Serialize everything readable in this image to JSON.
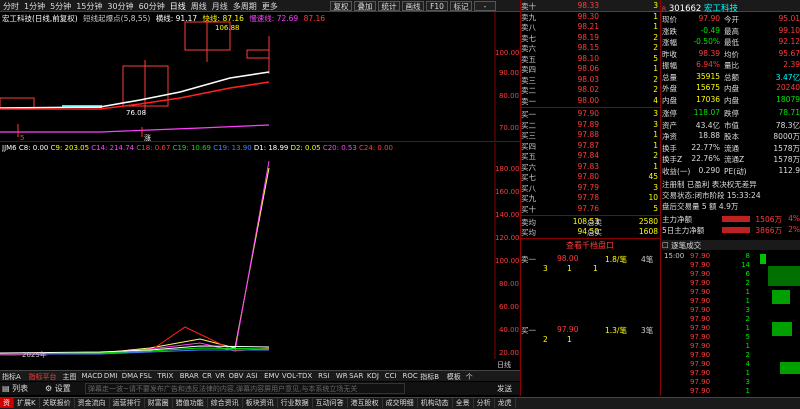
{
  "toolbar": {
    "periods": [
      "分时",
      "1分钟",
      "5分钟",
      "15分钟",
      "30分钟",
      "60分钟",
      "日线",
      "周线",
      "月线",
      "多周期",
      "更多"
    ],
    "active": "日线",
    "buttons": [
      "复权",
      "叠加",
      "统计",
      "画线",
      "F10",
      "标记",
      "-"
    ]
  },
  "chart_header": {
    "stock": "宏工科技(日线,前复权)",
    "indicator": "短线起爆点(5,8,55)",
    "s1": "横线: 91.17",
    "s2": "快线: 87.16",
    "s3": "慢速线: 72.69",
    "s4": "87.16"
  },
  "price_axis": [
    "100.00",
    "90.00",
    "80.00",
    "70.00"
  ],
  "annot": {
    "high": "106.88",
    "low": "76.08",
    "sig": "5",
    "sig2": "涨"
  },
  "sub_header": {
    "name": "JJM6",
    "c8": "C8: 0.00",
    "c9": "C9: 203.05",
    "c14": "C14: 214.74",
    "c18": "C18: 0.67",
    "c19": "C19: 10.69",
    "c19b": "C19: 13.90",
    "d1": "D1: 18.99",
    "d2": "D2: 0.05",
    "c20": "C20: 0.53",
    "c24": "C24: 0.00"
  },
  "sub_axis": [
    "180.00",
    "160.00",
    "140.00",
    "120.00",
    "100.00",
    "80.00",
    "60.00",
    "40.00",
    "20.00"
  ],
  "year": "2025年",
  "ind_tabs": [
    "指标A",
    "指标平台",
    "主图",
    "MACD",
    "DMI",
    "DMA",
    "FSL",
    "TRIX",
    "BRAR",
    "CR",
    "VR",
    "OBV",
    "ASI",
    "EMV",
    "VOL-TDX",
    "RSI",
    "WR",
    "SAR",
    "KDJ",
    "CCI",
    "ROC",
    "指标B",
    "模板",
    "个"
  ],
  "footer_left": {
    "list": "列表",
    "settings": "设置"
  },
  "footer_notice": "弹幕走一波~请不要发布广告和违反法律的内容,弹幕内容屏用户意见,与本系统立场无关",
  "footer_right": {
    "daily": "日线",
    "send": "发送"
  },
  "orderbook": {
    "asks": [
      {
        "l": "卖十",
        "p": "98.33",
        "v": "3"
      },
      {
        "l": "卖九",
        "p": "98.30",
        "v": "1"
      },
      {
        "l": "卖八",
        "p": "98.21",
        "v": "1"
      },
      {
        "l": "卖七",
        "p": "98.19",
        "v": "2"
      },
      {
        "l": "卖六",
        "p": "98.15",
        "v": "2"
      },
      {
        "l": "卖五",
        "p": "98.10",
        "v": "5"
      },
      {
        "l": "卖四",
        "p": "98.06",
        "v": "1"
      },
      {
        "l": "卖三",
        "p": "98.03",
        "v": "2"
      },
      {
        "l": "卖二",
        "p": "98.02",
        "v": "2"
      },
      {
        "l": "卖一",
        "p": "98.00",
        "v": "4"
      }
    ],
    "bids": [
      {
        "l": "买一",
        "p": "97.90",
        "v": "3"
      },
      {
        "l": "买二",
        "p": "97.89",
        "v": "3"
      },
      {
        "l": "买三",
        "p": "97.88",
        "v": "1"
      },
      {
        "l": "买四",
        "p": "97.87",
        "v": "1"
      },
      {
        "l": "买五",
        "p": "97.84",
        "v": "2"
      },
      {
        "l": "买六",
        "p": "97.83",
        "v": "1"
      },
      {
        "l": "买七",
        "p": "97.80",
        "v": "45"
      },
      {
        "l": "买八",
        "p": "97.79",
        "v": "3"
      },
      {
        "l": "买九",
        "p": "97.78",
        "v": "10"
      },
      {
        "l": "买十",
        "p": "97.76",
        "v": "5"
      }
    ],
    "avg_ask": {
      "l": "卖均",
      "p": "108.53",
      "tl": "总卖",
      "tv": "2580"
    },
    "avg_bid": {
      "l": "买均",
      "p": "94.50",
      "tl": "总买",
      "tv": "1608"
    }
  },
  "depth": {
    "title": "查看千档盘口",
    "ask": {
      "l": "卖一",
      "p": "98.00",
      "r": "1.8/笔",
      "c": "4笔",
      "q": [
        "3",
        "1",
        "1"
      ]
    },
    "bid": {
      "l": "买一",
      "p": "97.90",
      "r": "1.3/笔",
      "c": "3笔",
      "q": [
        "2",
        "1"
      ]
    }
  },
  "stock": {
    "code": "301662",
    "name": "宏工科技",
    "rows": [
      [
        "现价",
        "97.90",
        "今开",
        "95.01"
      ],
      [
        "涨跌",
        "-0.49",
        "最高",
        "99.10"
      ],
      [
        "涨幅",
        "-0.50%",
        "最低",
        "92.12"
      ],
      [
        "昨收",
        "98.39",
        "均价",
        "95.67"
      ],
      [
        "振幅",
        "6.94%",
        "量比",
        "2.39"
      ],
      [
        "总量",
        "35915",
        "总额",
        "3.47亿"
      ],
      [
        "外盘",
        "15675",
        "内盘",
        "20240"
      ],
      [
        "内盘",
        "17036",
        "内盘",
        "18079"
      ],
      [
        "涨停",
        "118.07",
        "跌停",
        "78.71"
      ],
      [
        "资产",
        "43.4亿",
        "市值",
        "78.3亿"
      ],
      [
        "净资",
        "18.88",
        "股本",
        "8000万"
      ],
      [
        "换手",
        "22.77%",
        "流通",
        "1578万"
      ],
      [
        "换手Z",
        "22.76%",
        "流通Z",
        "1578万"
      ],
      [
        "收益(一)",
        "0.290",
        "PE(动)",
        "112.9"
      ]
    ],
    "tags": "注册制 已盈利 表决权无差异",
    "status": "交易状态:闭市阶段 15:33:24",
    "after": "盘后交易量 5 额 4.9万",
    "flow": [
      {
        "l": "主力净额",
        "v": "1506万",
        "p": "4%"
      },
      {
        "l": "5日主力净额",
        "v": "3866万",
        "p": "2%"
      }
    ]
  },
  "ticks": {
    "title": "逐笔成交",
    "rows": [
      [
        "15:00",
        "97.90",
        "8"
      ],
      [
        "",
        "97.90",
        "14"
      ],
      [
        "",
        "97.90",
        "6"
      ],
      [
        "",
        "97.90",
        "2"
      ],
      [
        "",
        "97.90",
        "1"
      ],
      [
        "",
        "97.90",
        "1"
      ],
      [
        "",
        "97.90",
        "3"
      ],
      [
        "",
        "97.90",
        "2"
      ],
      [
        "",
        "97.90",
        "1"
      ],
      [
        "",
        "97.90",
        "5"
      ],
      [
        "",
        "97.90",
        "1"
      ],
      [
        "",
        "97.90",
        "2"
      ],
      [
        "",
        "97.90",
        "4"
      ],
      [
        "",
        "97.90",
        "1"
      ],
      [
        "",
        "97.90",
        "3"
      ],
      [
        "",
        "97.90",
        "1"
      ]
    ]
  },
  "bottom_bar": [
    "资",
    "扩展K",
    "关联报价",
    "资金流向",
    "运营排行",
    "财富圈",
    "猎值功能",
    "综合资讯",
    "板块资讯",
    "行业数据",
    "互动问答",
    "港互股权",
    "成交明细",
    "机构动态",
    "全景",
    "分析",
    "龙虎"
  ]
}
